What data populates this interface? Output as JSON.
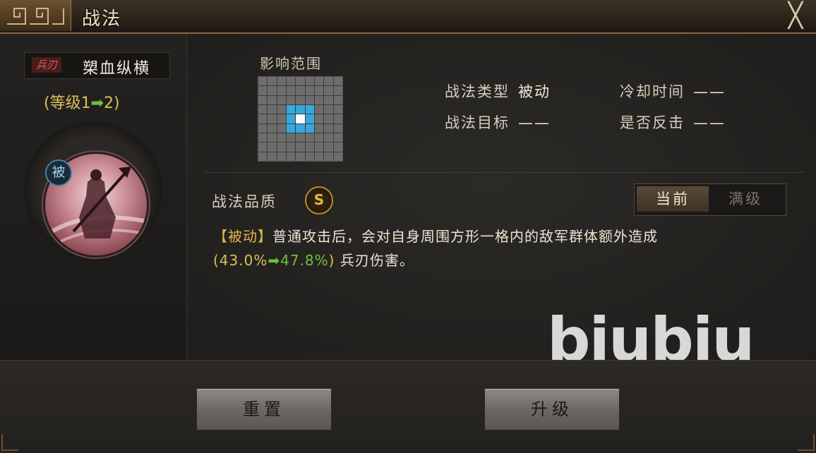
{
  "window": {
    "title": "战法",
    "close_label": "╳"
  },
  "skill": {
    "type_tag": "兵刃",
    "name": "槊血纵横",
    "level_prefix": "(等级1",
    "level_arrow": "➡",
    "level_suffix": "2)",
    "passive_badge": "被"
  },
  "range": {
    "label": "影响范围",
    "grid_size": 9,
    "highlighted": "3x3 square around center"
  },
  "info": {
    "type_label": "战法类型",
    "type_value": "被动",
    "cooldown_label": "冷却时间",
    "cooldown_value": "——",
    "target_label": "战法目标",
    "target_value": "——",
    "counter_label": "是否反击",
    "counter_value": "——"
  },
  "quality": {
    "label": "战法品质",
    "grade": "S"
  },
  "toggle": {
    "current": "当前",
    "max": "满级"
  },
  "description": {
    "tag": "【被动】",
    "line1": "普通攻击后，会对自身周围方形一格内的敌军群体额外造成",
    "from": "(43.0%",
    "arrow": "➡",
    "to": "47.8%",
    "close_paren": ")",
    "tail": " 兵刃伤害。"
  },
  "watermark": "biubiu",
  "buttons": {
    "reset": "重置",
    "upgrade": "升级"
  },
  "colors": {
    "accent_gold": "#e2b946",
    "arrow_green": "#6ec03a",
    "range_blue": "#37a8dd"
  }
}
